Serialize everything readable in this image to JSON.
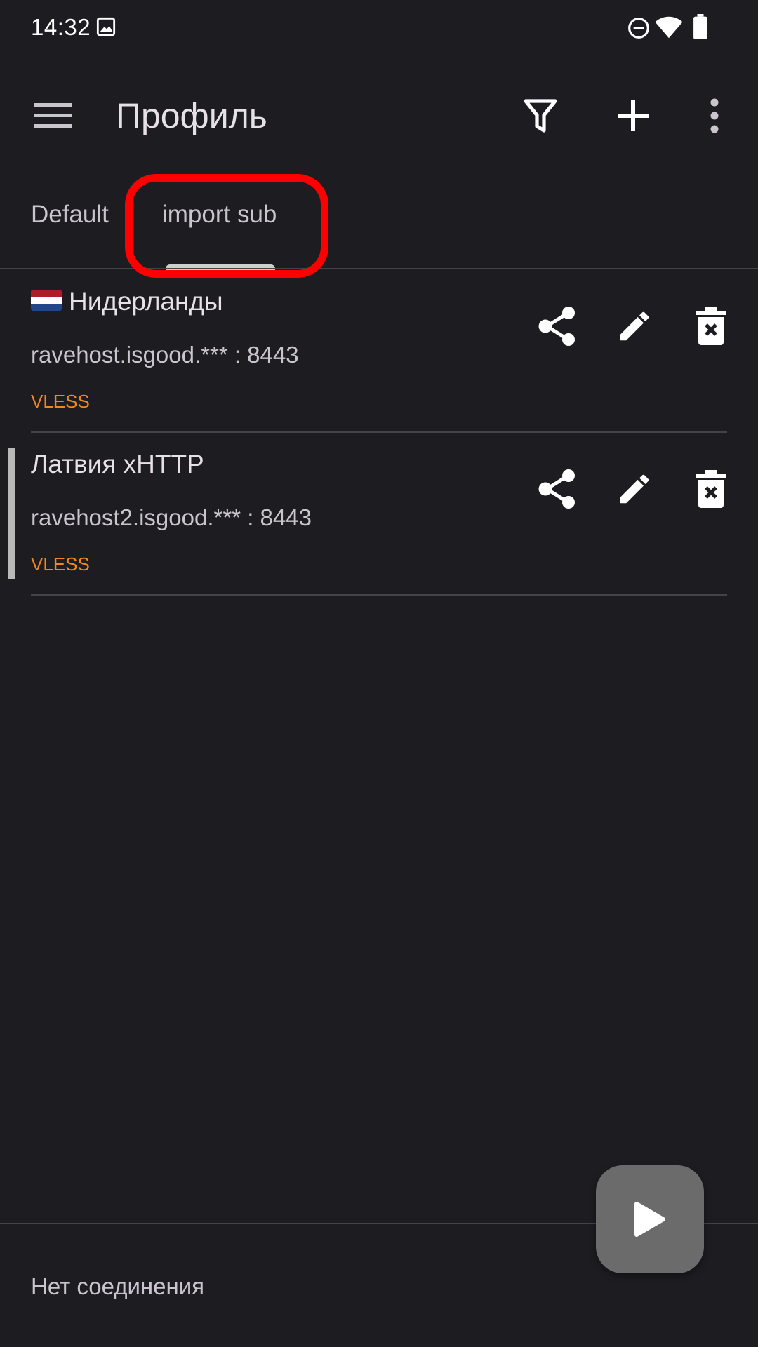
{
  "status_bar": {
    "time": "14:32",
    "icons": [
      "image-icon",
      "do-not-disturb-icon",
      "wifi-icon",
      "battery-icon"
    ]
  },
  "app_bar": {
    "title": "Профиль",
    "actions": [
      "filter-icon",
      "add-icon",
      "more-vert-icon"
    ]
  },
  "tabs": [
    {
      "label": "Default",
      "selected": false
    },
    {
      "label": "import sub",
      "selected": true
    }
  ],
  "profiles": [
    {
      "flag": "netherlands-flag",
      "name": "Нидерланды",
      "address": "ravehost.isgood.*** : 8443",
      "type": "VLESS",
      "active": false
    },
    {
      "name": "Латвия xHTTP",
      "address": "ravehost2.isgood.*** : 8443",
      "type": "VLESS",
      "active": true
    }
  ],
  "footer": {
    "status": "Нет соединения"
  },
  "colors": {
    "background": "#1c1c21",
    "protocol_accent": "#f0871f",
    "highlight": "#ff0000",
    "fab": "#6b6b6b"
  }
}
